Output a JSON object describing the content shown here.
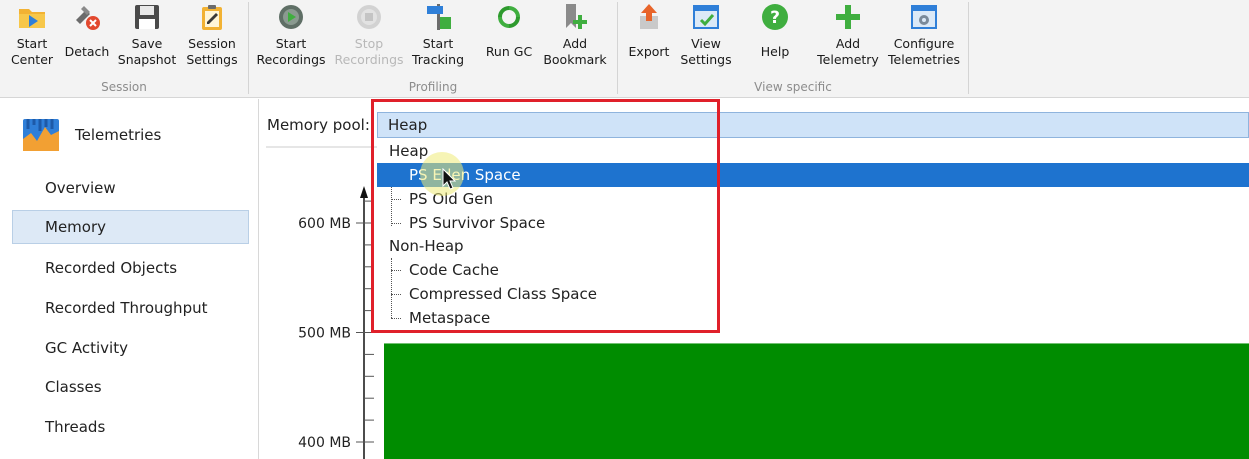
{
  "toolbar": {
    "groups": [
      {
        "label": "Session"
      },
      {
        "label": "Profiling"
      },
      {
        "label": "View specific"
      }
    ],
    "buttons": [
      {
        "id": "start-center",
        "label": "Start\nCenter",
        "icon": "start-center-icon"
      },
      {
        "id": "detach",
        "label": "Detach",
        "icon": "detach-icon"
      },
      {
        "id": "save-snapshot",
        "label": "Save\nSnapshot",
        "icon": "save-icon"
      },
      {
        "id": "session-settings",
        "label": "Session\nSettings",
        "icon": "session-settings-icon"
      },
      {
        "id": "start-recordings",
        "label": "Start\nRecordings",
        "icon": "start-recordings-icon"
      },
      {
        "id": "stop-recordings",
        "label": "Stop\nRecordings",
        "icon": "stop-recordings-icon",
        "disabled": true
      },
      {
        "id": "start-tracking",
        "label": "Start\nTracking",
        "icon": "start-tracking-icon"
      },
      {
        "id": "run-gc",
        "label": "Run GC",
        "icon": "run-gc-icon"
      },
      {
        "id": "add-bookmark",
        "label": "Add\nBookmark",
        "icon": "add-bookmark-icon"
      },
      {
        "id": "export",
        "label": "Export",
        "icon": "export-icon"
      },
      {
        "id": "view-settings",
        "label": "View\nSettings",
        "icon": "view-settings-icon"
      },
      {
        "id": "help",
        "label": "Help",
        "icon": "help-icon"
      },
      {
        "id": "add-telemetry",
        "label": "Add\nTelemetry",
        "icon": "add-telemetry-icon"
      },
      {
        "id": "configure-telemetries",
        "label": "Configure\nTelemetries",
        "icon": "configure-telemetries-icon"
      }
    ]
  },
  "sidebar": {
    "title": "Telemetries",
    "items": [
      {
        "label": "Overview",
        "active": false
      },
      {
        "label": "Memory",
        "active": true
      },
      {
        "label": "Recorded Objects",
        "active": false
      },
      {
        "label": "Recorded Throughput",
        "active": false
      },
      {
        "label": "GC Activity",
        "active": false
      },
      {
        "label": "Classes",
        "active": false
      },
      {
        "label": "Threads",
        "active": false
      }
    ]
  },
  "main": {
    "pool_label": "Memory pool:",
    "pool_selected": "Heap",
    "dropdown": [
      {
        "label": "Heap",
        "level": 0
      },
      {
        "label": "PS Eden Space",
        "level": 1,
        "selected": true
      },
      {
        "label": "PS Old Gen",
        "level": 1
      },
      {
        "label": "PS Survivor Space",
        "level": 1
      },
      {
        "label": "Non-Heap",
        "level": 0
      },
      {
        "label": "Code Cache",
        "level": 1
      },
      {
        "label": "Compressed Class Space",
        "level": 1
      },
      {
        "label": "Metaspace",
        "level": 1
      }
    ]
  },
  "chart_data": {
    "type": "area",
    "y_ticks": [
      "600 MB",
      "500 MB",
      "400 MB"
    ],
    "y_tick_values": [
      600,
      500,
      400
    ],
    "ylim": [
      400,
      600
    ],
    "series": [
      {
        "values": [
          490
        ],
        "color": "#008c00"
      }
    ]
  },
  "colors": {
    "selection": "#1e73cf",
    "highlight_box": "#e0202a",
    "chart_fill": "#008c00"
  }
}
